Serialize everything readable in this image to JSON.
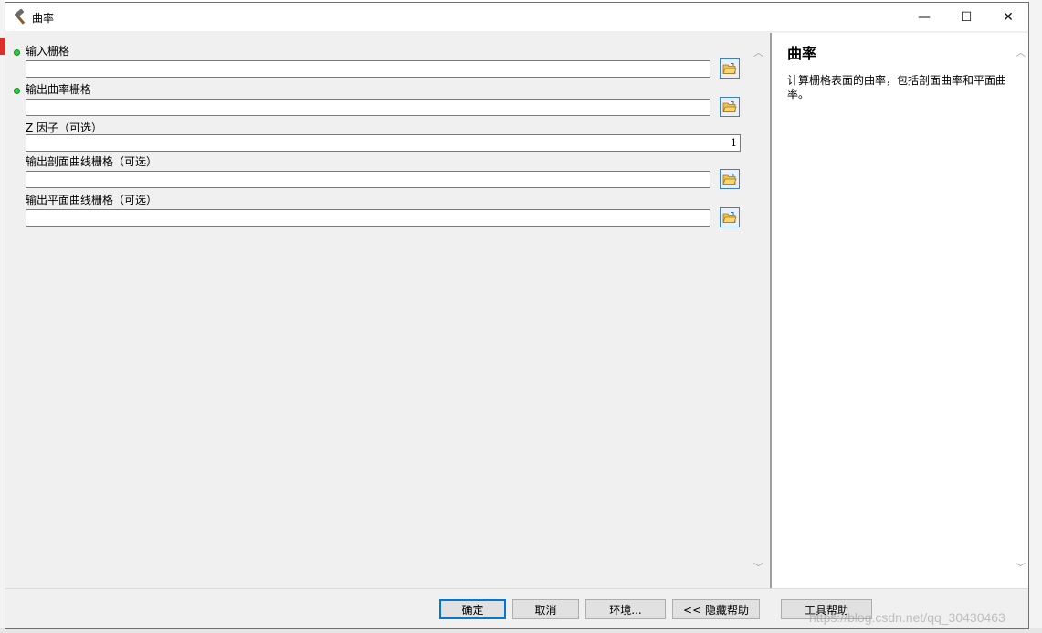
{
  "window": {
    "title": "曲率",
    "controls": {
      "minimize": "—",
      "maximize": "☐",
      "close": "✕"
    }
  },
  "form": {
    "fields": [
      {
        "label": "输入栅格",
        "value": "",
        "required": true,
        "browse": true
      },
      {
        "label": "输出曲率栅格",
        "value": "",
        "required": true,
        "browse": true
      },
      {
        "label": "Z 因子（可选）",
        "value": "1",
        "required": false,
        "browse": false
      },
      {
        "label": "输出剖面曲线栅格（可选）",
        "value": "",
        "required": false,
        "browse": true
      },
      {
        "label": "输出平面曲线栅格（可选）",
        "value": "",
        "required": false,
        "browse": true
      }
    ],
    "scroll": {
      "up": "︿",
      "down": "﹀"
    }
  },
  "help": {
    "title": "曲率",
    "body": "计算栅格表面的曲率，包括剖面曲率和平面曲率。"
  },
  "buttons": {
    "ok": "确定",
    "cancel": "取消",
    "environments": "环境...",
    "hide_help": "<< 隐藏帮助",
    "tool_help": "工具帮助"
  },
  "watermark": "https://blog.csdn.net/qq_30430463",
  "colors": {
    "required_dot": "#2ecc40",
    "default_button_border": "#0078d7",
    "folder": "#f2c14e"
  }
}
